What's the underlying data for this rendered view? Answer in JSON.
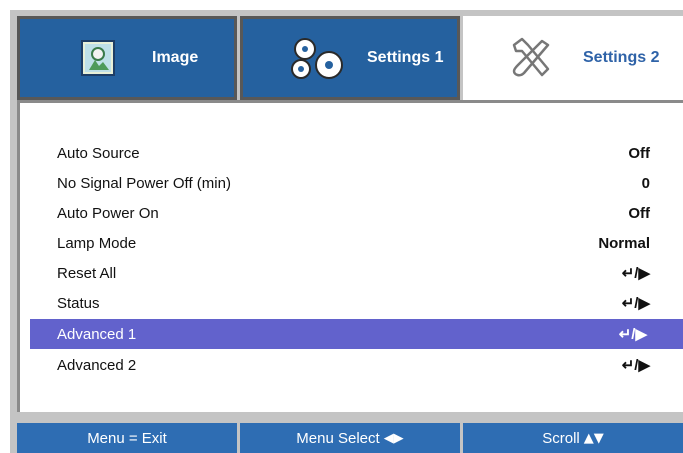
{
  "tabs": [
    {
      "label": "Image",
      "icon": "image-icon",
      "active": false
    },
    {
      "label": "Settings 1",
      "icon": "gears-icon",
      "active": false
    },
    {
      "label": "Settings 2",
      "icon": "tools-icon",
      "active": true
    }
  ],
  "menu": {
    "items": [
      {
        "label": "Auto Source",
        "value": "Off",
        "selected": false
      },
      {
        "label": "No Signal Power Off (min)",
        "value": "0",
        "selected": false
      },
      {
        "label": "Auto Power On",
        "value": "Off",
        "selected": false
      },
      {
        "label": "Lamp Mode",
        "value": "Normal",
        "selected": false
      },
      {
        "label": "Reset All",
        "value": "↵/▶",
        "selected": false
      },
      {
        "label": "Status",
        "value": "↵/▶",
        "selected": false
      },
      {
        "label": "Advanced 1",
        "value": "↵/▶",
        "selected": true
      },
      {
        "label": "Advanced 2",
        "value": "↵/▶",
        "selected": false
      }
    ]
  },
  "footer": {
    "exit_hint": "Menu = Exit",
    "select_hint": "Menu Select",
    "select_glyph": "◀▶",
    "scroll_hint": "Scroll",
    "scroll_glyph": "▲▼"
  },
  "colors": {
    "tab_blue": "#25619f",
    "selection": "#6262cc",
    "footer_blue": "#2e6db3",
    "frame_gray": "#c4c4c4"
  }
}
